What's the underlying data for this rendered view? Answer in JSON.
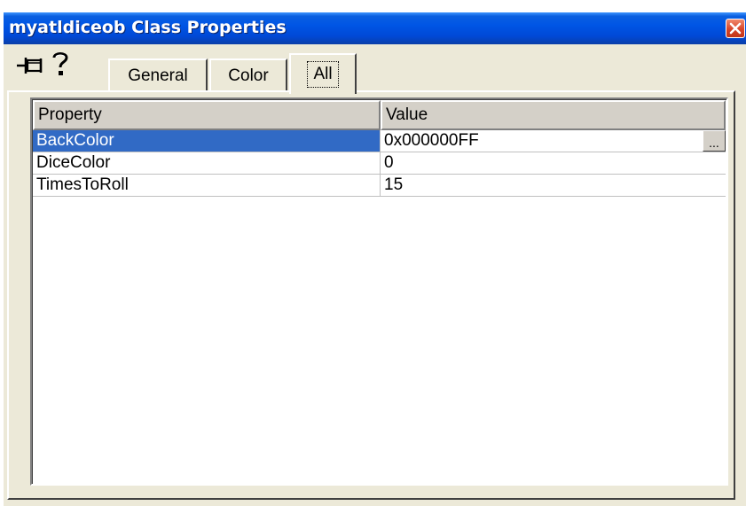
{
  "window": {
    "title": "myatldiceob Class Properties"
  },
  "toolbar": {
    "pin_icon": "pushpin-icon",
    "help_icon": "help-question-icon"
  },
  "tabs": [
    {
      "label": "General"
    },
    {
      "label": "Color"
    },
    {
      "label": "All"
    }
  ],
  "active_tab": "All",
  "grid": {
    "headers": {
      "property": "Property",
      "value": "Value"
    },
    "rows": [
      {
        "name": "BackColor",
        "value": "0x000000FF",
        "selected": true,
        "button": "..."
      },
      {
        "name": "DiceColor",
        "value": "0"
      },
      {
        "name": "TimesToRoll",
        "value": "15"
      }
    ]
  },
  "colors": {
    "titlebar": "#0055e5",
    "selection": "#316ac5",
    "face": "#ece9d8"
  }
}
